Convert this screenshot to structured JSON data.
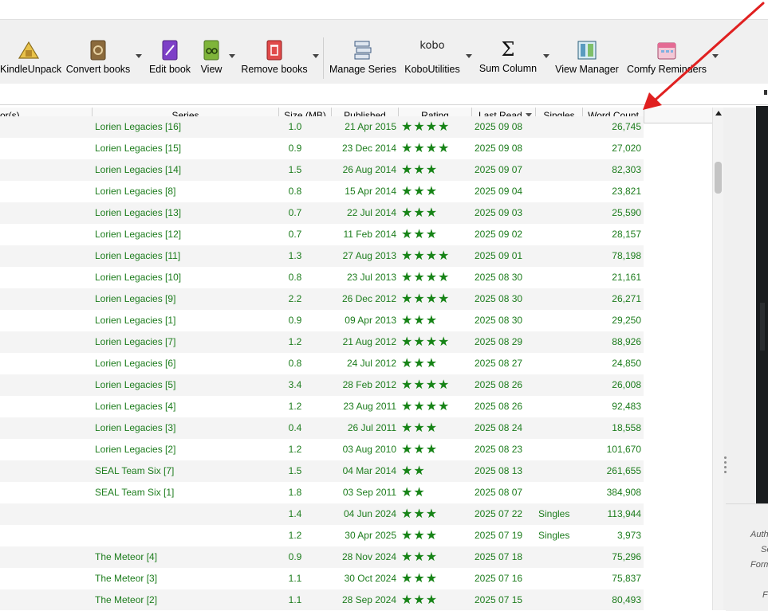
{
  "toolbar": {
    "kindleunpack_label": "KindleUnpack",
    "convert_label": "Convert books",
    "edit_label": "Edit book",
    "view_label": "View",
    "remove_label": "Remove books",
    "manage_series_label": "Manage Series",
    "kobo_label": "KoboUtilities",
    "kobo_icon_text": "kobo",
    "sum_column_label": "Sum Column",
    "sum_icon_text": "Σ",
    "view_manager_label": "View Manager",
    "comfy_label": "Comfy Reminders"
  },
  "table": {
    "headers": {
      "authors": "or(s)",
      "series": "Series",
      "size": "Size (MB)",
      "published": "Published",
      "rating": "Rating",
      "last_read": "Last Read",
      "singles": "Singles",
      "word_count": "Word Count"
    },
    "rows": [
      {
        "series": "Lorien Legacies [16]",
        "size": "1.0",
        "published": "21 Apr 2015",
        "rating": "★★★★",
        "last_read": "2025 09 08",
        "singles": "",
        "word_count": "26,745"
      },
      {
        "series": "Lorien Legacies [15]",
        "size": "0.9",
        "published": "23 Dec 2014",
        "rating": "★★★★",
        "last_read": "2025 09 08",
        "singles": "",
        "word_count": "27,020"
      },
      {
        "series": "Lorien Legacies [14]",
        "size": "1.5",
        "published": "26 Aug 2014",
        "rating": "★★★",
        "last_read": "2025 09 07",
        "singles": "",
        "word_count": "82,303"
      },
      {
        "series": "Lorien Legacies [8]",
        "size": "0.8",
        "published": "15 Apr 2014",
        "rating": "★★★",
        "last_read": "2025 09 04",
        "singles": "",
        "word_count": "23,821"
      },
      {
        "series": "Lorien Legacies [13]",
        "size": "0.7",
        "published": "22 Jul 2014",
        "rating": "★★★",
        "last_read": "2025 09 03",
        "singles": "",
        "word_count": "25,590"
      },
      {
        "series": "Lorien Legacies [12]",
        "size": "0.7",
        "published": "11 Feb 2014",
        "rating": "★★★",
        "last_read": "2025 09 02",
        "singles": "",
        "word_count": "28,157"
      },
      {
        "series": "Lorien Legacies [11]",
        "size": "1.3",
        "published": "27 Aug 2013",
        "rating": "★★★★",
        "last_read": "2025 09 01",
        "singles": "",
        "word_count": "78,198"
      },
      {
        "series": "Lorien Legacies [10]",
        "size": "0.8",
        "published": "23 Jul 2013",
        "rating": "★★★★",
        "last_read": "2025 08 30",
        "singles": "",
        "word_count": "21,161"
      },
      {
        "series": "Lorien Legacies [9]",
        "size": "2.2",
        "published": "26 Dec 2012",
        "rating": "★★★★",
        "last_read": "2025 08 30",
        "singles": "",
        "word_count": "26,271"
      },
      {
        "series": "Lorien Legacies [1]",
        "size": "0.9",
        "published": "09 Apr 2013",
        "rating": "★★★",
        "last_read": "2025 08 30",
        "singles": "",
        "word_count": "29,250"
      },
      {
        "series": "Lorien Legacies [7]",
        "size": "1.2",
        "published": "21 Aug 2012",
        "rating": "★★★★",
        "last_read": "2025 08 29",
        "singles": "",
        "word_count": "88,926"
      },
      {
        "series": "Lorien Legacies [6]",
        "size": "0.8",
        "published": "24 Jul 2012",
        "rating": "★★★",
        "last_read": "2025 08 27",
        "singles": "",
        "word_count": "24,850"
      },
      {
        "series": "Lorien Legacies [5]",
        "size": "3.4",
        "published": "28 Feb 2012",
        "rating": "★★★★",
        "last_read": "2025 08 26",
        "singles": "",
        "word_count": "26,008"
      },
      {
        "series": "Lorien Legacies [4]",
        "size": "1.2",
        "published": "23 Aug 2011",
        "rating": "★★★★",
        "last_read": "2025 08 26",
        "singles": "",
        "word_count": "92,483"
      },
      {
        "series": "Lorien Legacies [3]",
        "size": "0.4",
        "published": "26 Jul 2011",
        "rating": "★★★",
        "last_read": "2025 08 24",
        "singles": "",
        "word_count": "18,558"
      },
      {
        "series": "Lorien Legacies [2]",
        "size": "1.2",
        "published": "03 Aug 2010",
        "rating": "★★★",
        "last_read": "2025 08 23",
        "singles": "",
        "word_count": "101,670"
      },
      {
        "series": "SEAL Team Six [7]",
        "size": "1.5",
        "published": "04 Mar 2014",
        "rating": "★★",
        "last_read": "2025 08 13",
        "singles": "",
        "word_count": "261,655"
      },
      {
        "series": "SEAL Team Six [1]",
        "size": "1.8",
        "published": "03 Sep 2011",
        "rating": "★★",
        "last_read": "2025 08 07",
        "singles": "",
        "word_count": "384,908"
      },
      {
        "series": "",
        "size": "1.4",
        "published": "04 Jun 2024",
        "rating": "★★★",
        "last_read": "2025 07 22",
        "singles": "Singles",
        "word_count": "113,944"
      },
      {
        "series": "",
        "size": "1.2",
        "published": "30 Apr 2025",
        "rating": "★★★",
        "last_read": "2025 07 19",
        "singles": "Singles",
        "word_count": "3,973"
      },
      {
        "series": "The Meteor [4]",
        "size": "0.9",
        "published": "28 Nov 2024",
        "rating": "★★★",
        "last_read": "2025 07 18",
        "singles": "",
        "word_count": "75,296"
      },
      {
        "series": "The Meteor [3]",
        "size": "1.1",
        "published": "30 Oct 2024",
        "rating": "★★★",
        "last_read": "2025 07 16",
        "singles": "",
        "word_count": "75,837"
      },
      {
        "series": "The Meteor [2]",
        "size": "1.1",
        "published": "28 Sep 2024",
        "rating": "★★★",
        "last_read": "2025 07 15",
        "singles": "",
        "word_count": "80,493"
      }
    ]
  },
  "details_panel": {
    "lines": [
      "Auth",
      "Se",
      "Form",
      "",
      "Fo"
    ]
  },
  "colors": {
    "cell_text": "#1c7c1c",
    "star": "#178417",
    "annotation_arrow": "#e02020"
  }
}
